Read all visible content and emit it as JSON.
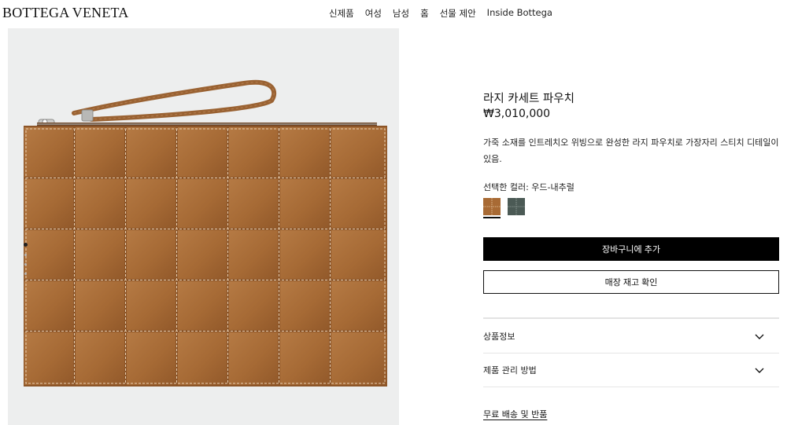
{
  "brand": {
    "logo_text": "BOTTEGA VENETA"
  },
  "nav": {
    "items": [
      "신제품",
      "여성",
      "남성",
      "홈",
      "선물 제안",
      "Inside Bottega"
    ]
  },
  "gallery": {
    "image_count": 4,
    "active_index": 0,
    "product_color": "#a86a34"
  },
  "product": {
    "title": "라지 카세트 파우치",
    "price": "₩3,010,000",
    "description": "가죽 소재를 인트레치오 위빙으로 완성한 라지 파우치로 가장자리 스티치 디테일이 있음.",
    "color_label": "선택한 컬러: 우드-내추럴",
    "swatches": [
      {
        "name": "wood-natural",
        "color": "#a86a34",
        "selected": true
      },
      {
        "name": "dark-green",
        "color": "#4b5a55",
        "selected": false
      }
    ]
  },
  "actions": {
    "add_to_cart": "장바구니에 추가",
    "check_store_stock": "매장 재고 확인"
  },
  "accordion": {
    "items": [
      {
        "label": "상품정보",
        "icon": "chevron-down-icon"
      },
      {
        "label": "제품 관리 방법",
        "icon": "chevron-down-icon"
      }
    ]
  },
  "links": {
    "shipping_returns": "무료 배송 및 반품"
  }
}
